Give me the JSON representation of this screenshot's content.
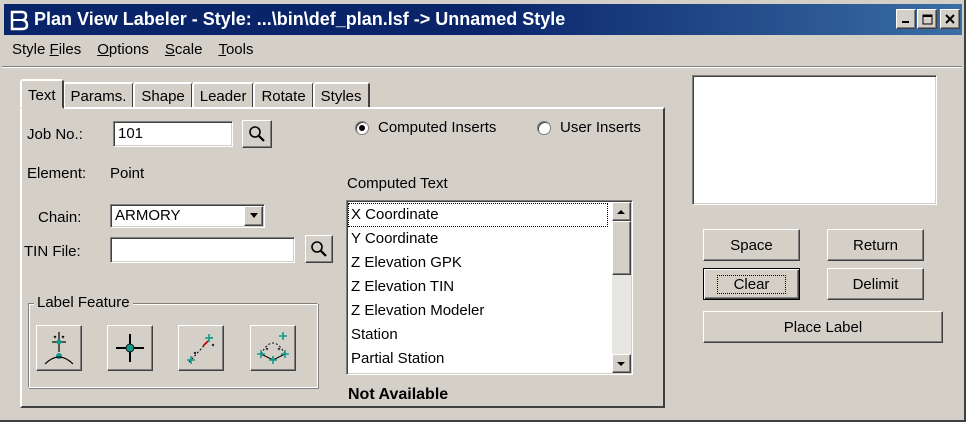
{
  "window": {
    "title": "Plan View Labeler - Style: ...\\bin\\def_plan.lsf -> Unnamed Style",
    "app_icon": "bentley-b-icon",
    "controls": [
      "minimize-icon",
      "maximize-icon",
      "close-icon"
    ]
  },
  "menu": {
    "items": [
      {
        "label": "Style Files",
        "underline_char": "F"
      },
      {
        "label": "Options",
        "underline_char": "O"
      },
      {
        "label": "Scale",
        "underline_char": "S"
      },
      {
        "label": "Tools",
        "underline_char": "T"
      }
    ]
  },
  "tabs": [
    {
      "label": "Text",
      "active": true
    },
    {
      "label": "Params.",
      "active": false
    },
    {
      "label": "Shape",
      "active": false
    },
    {
      "label": "Leader",
      "active": false
    },
    {
      "label": "Rotate",
      "active": false
    },
    {
      "label": "Styles",
      "active": false
    }
  ],
  "text_tab": {
    "job_label": "Job No.:",
    "job_value": "101",
    "element_label": "Element:",
    "element_value": "Point",
    "chain_label": "Chain:",
    "chain_value": "ARMORY",
    "tin_label": "TIN File:",
    "tin_value": "",
    "label_feature_title": "Label Feature",
    "feature_buttons": [
      "point-label-icon",
      "crosshair-point-icon",
      "line-segment-icon",
      "arc-curve-icon"
    ],
    "radio_computed": "Computed Inserts",
    "radio_user": "User Inserts",
    "radio_selected": "computed",
    "computed_text_label": "Computed Text",
    "computed_text_items": [
      "X Coordinate",
      "Y Coordinate",
      "Z Elevation GPK",
      "Z Elevation TIN",
      "Z Elevation Modeler",
      "Station",
      "Partial Station"
    ],
    "status": "Not Available"
  },
  "right_panel": {
    "preview_text": "",
    "buttons": {
      "space": "Space",
      "return": "Return",
      "clear": "Clear",
      "delimit": "Delimit",
      "place_label": "Place Label"
    }
  },
  "colors": {
    "titlebar_start": "#0a246a",
    "titlebar_end": "#3a6ea5",
    "face": "#d4d0c8"
  }
}
